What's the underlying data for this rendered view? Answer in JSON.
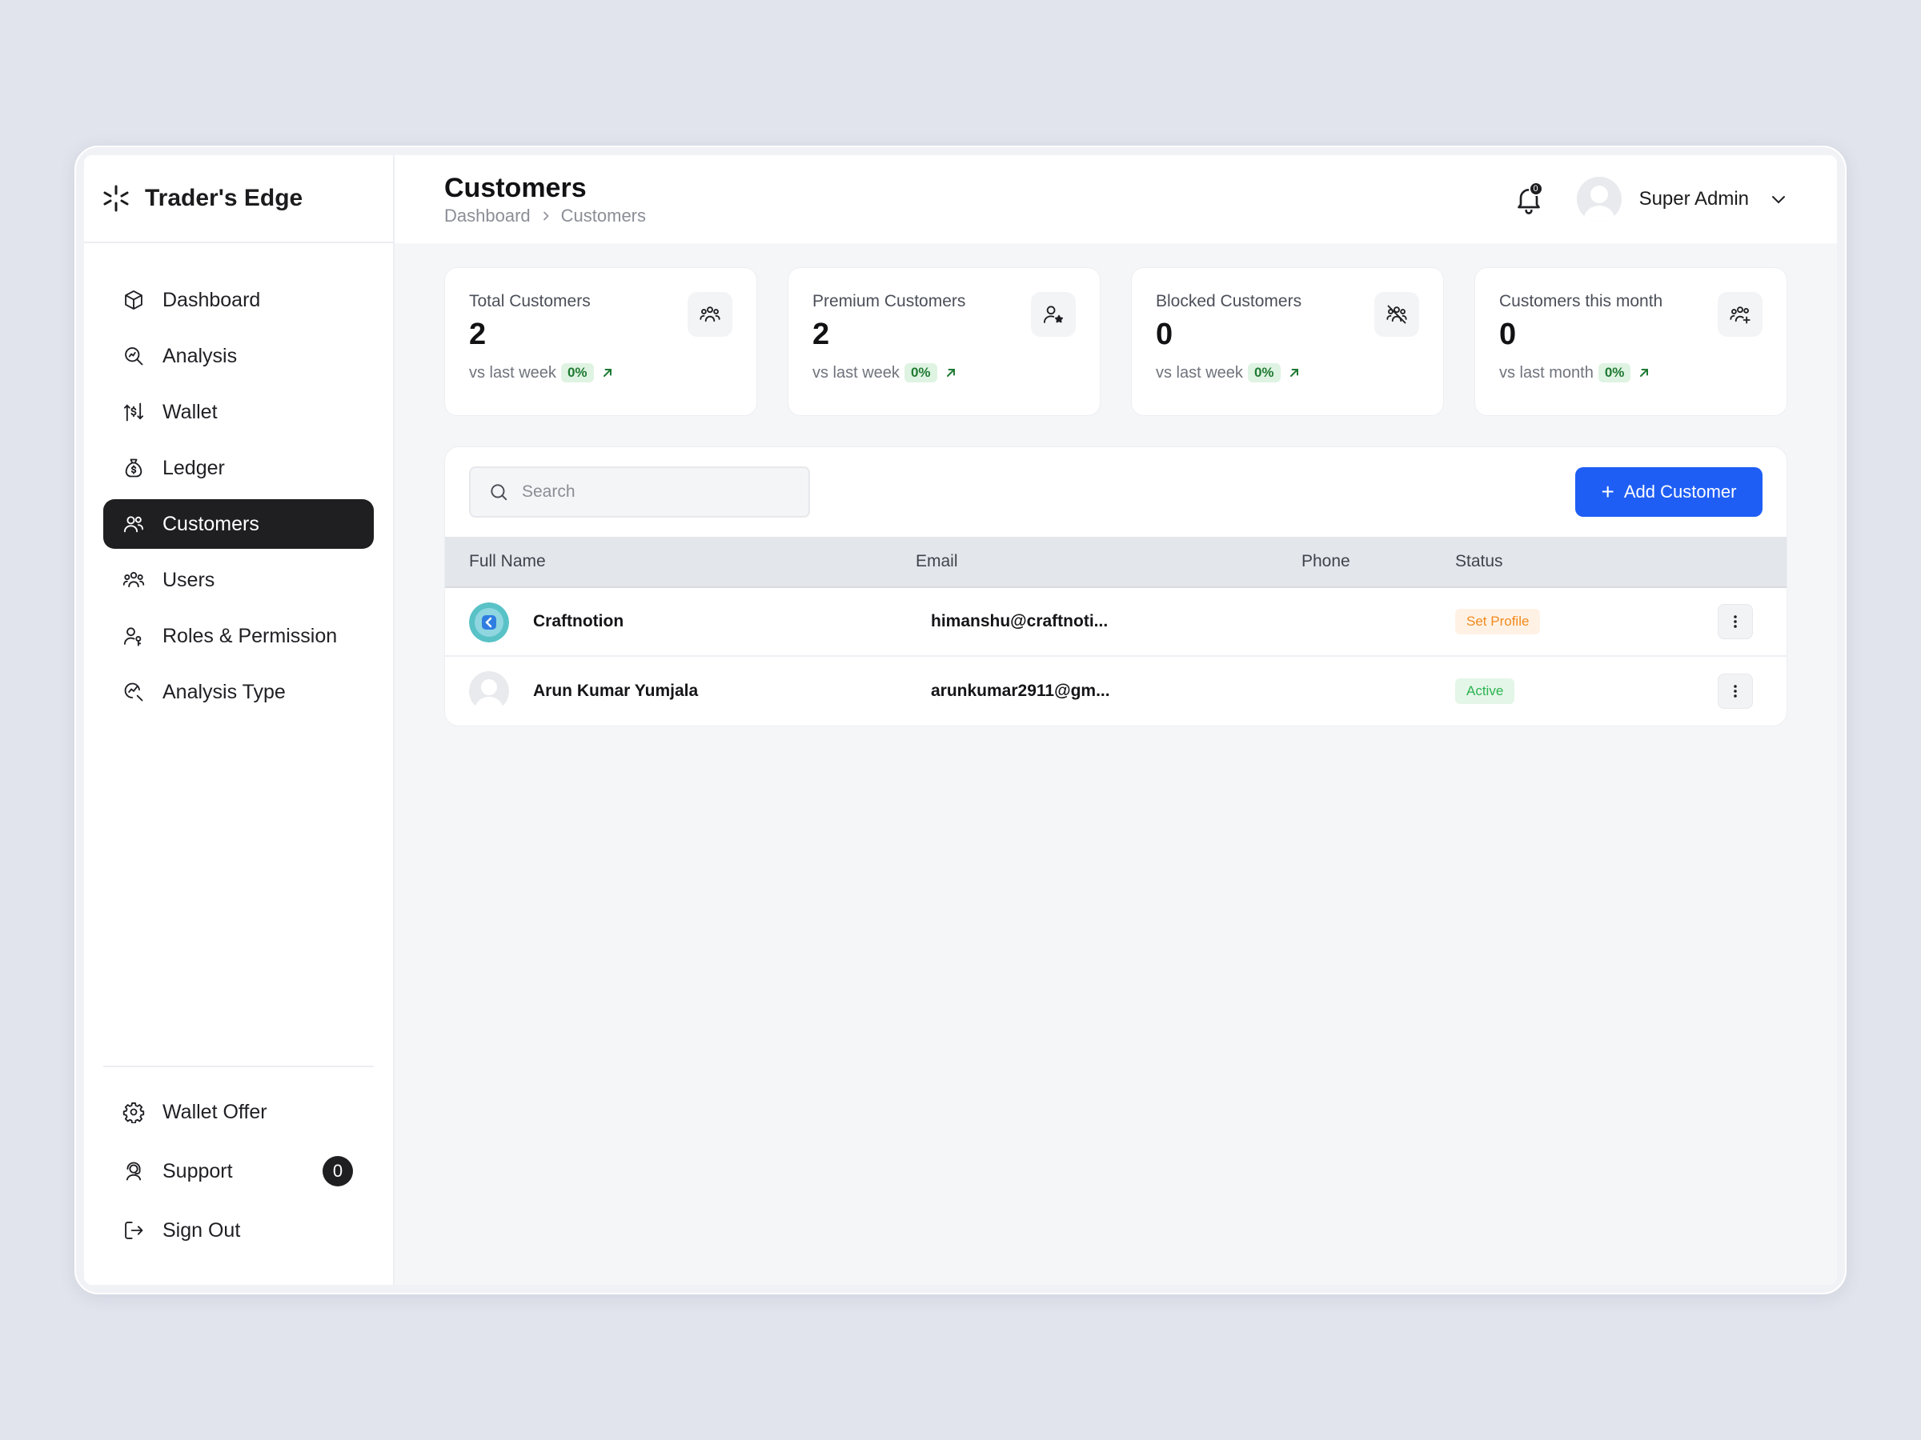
{
  "app": {
    "name": "Trader's Edge"
  },
  "sidebar": {
    "items": [
      {
        "label": "Dashboard",
        "icon": "cube-icon"
      },
      {
        "label": "Analysis",
        "icon": "analysis-search-icon"
      },
      {
        "label": "Wallet",
        "icon": "wallet-transfer-icon"
      },
      {
        "label": "Ledger",
        "icon": "money-bag-icon"
      },
      {
        "label": "Customers",
        "icon": "customers-icon",
        "active": true
      },
      {
        "label": "Users",
        "icon": "users-icon"
      },
      {
        "label": "Roles & Permission",
        "icon": "user-key-icon"
      },
      {
        "label": "Analysis Type",
        "icon": "search-chart-icon"
      }
    ],
    "bottom": [
      {
        "label": "Wallet Offer",
        "icon": "gear-icon"
      },
      {
        "label": "Support",
        "icon": "support-icon",
        "badge": "0"
      },
      {
        "label": "Sign Out",
        "icon": "sign-out-icon"
      }
    ]
  },
  "header": {
    "title": "Customers",
    "breadcrumb": [
      "Dashboard",
      "Customers"
    ],
    "notification_count": "0",
    "user_name": "Super Admin"
  },
  "stats": [
    {
      "label": "Total Customers",
      "value": "2",
      "compare": "vs last week",
      "change": "0%",
      "icon": "customers-group-icon"
    },
    {
      "label": "Premium Customers",
      "value": "2",
      "compare": "vs last week",
      "change": "0%",
      "icon": "user-star-icon"
    },
    {
      "label": "Blocked Customers",
      "value": "0",
      "compare": "vs last week",
      "change": "0%",
      "icon": "users-blocked-icon"
    },
    {
      "label": "Customers this month",
      "value": "0",
      "compare": "vs last month",
      "change": "0%",
      "icon": "users-add-icon"
    }
  ],
  "table": {
    "search_placeholder": "Search",
    "add_button": "Add Customer",
    "columns": [
      "Full Name",
      "Email",
      "Phone",
      "Status"
    ],
    "rows": [
      {
        "name": "Craftnotion",
        "email": "himanshu@craftnoti...",
        "phone": "",
        "status": "Set Profile",
        "status_color": "#f08a1c"
      },
      {
        "name": "Arun Kumar Yumjala",
        "email": "arunkumar2911@gm...",
        "phone": "",
        "status": "Active",
        "status_color": "#2bb34f"
      }
    ]
  },
  "colors": {
    "accent": "#1f5ef5",
    "active_nav": "#1f1f21",
    "positive": "#1f7a33"
  }
}
